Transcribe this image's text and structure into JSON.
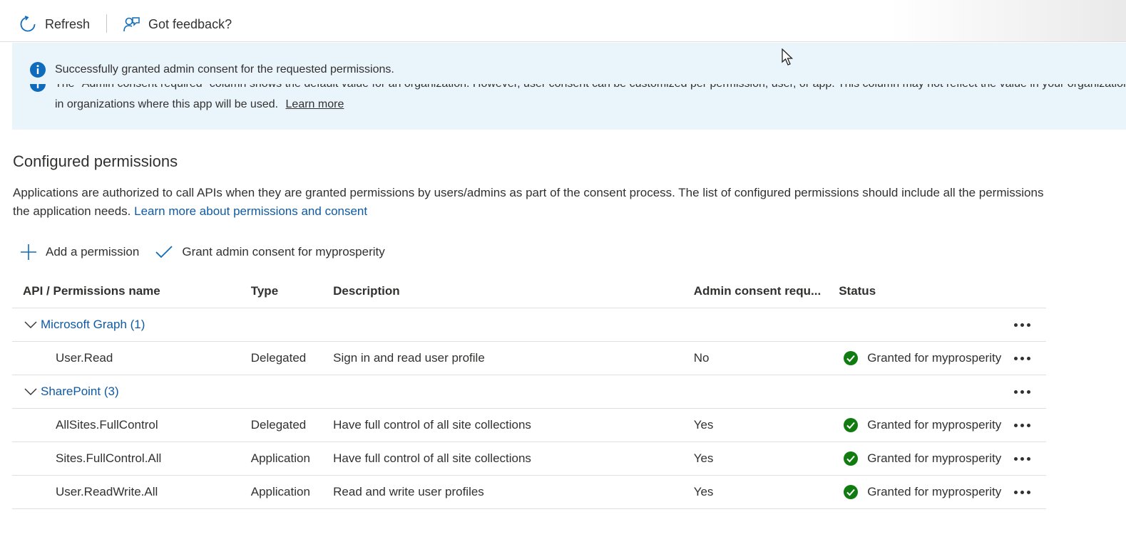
{
  "toolbar": {
    "refresh_label": "Refresh",
    "refresh_icon": "refresh-icon",
    "feedback_label": "Got feedback?",
    "feedback_icon": "feedback-icon"
  },
  "banner": {
    "success_message": "Successfully granted admin consent for the requested permissions.",
    "partial_line": "The \"Admin consent required\" column shows the default value for an organization. However, user consent can be customized per permission, user, or app. This column may not reflect the value in your organization, or",
    "info_text": "in organizations where this app will be used.",
    "learn_more": "Learn more",
    "info_color": "#0f6cbd",
    "background": "#eaf4fb"
  },
  "section": {
    "title": "Configured permissions",
    "description": "Applications are authorized to call APIs when they are granted permissions by users/admins as part of the consent process. The list of configured permissions should include all the permissions the application needs.",
    "link": "Learn more about permissions and consent"
  },
  "actions": {
    "add_permission": "Add a permission",
    "grant_consent": "Grant admin consent for myprosperity"
  },
  "table": {
    "headers": [
      "API / Permissions name",
      "Type",
      "Description",
      "Admin consent requ...",
      "Status"
    ],
    "groups": [
      {
        "name": "Microsoft Graph (1)",
        "rows": [
          {
            "name": "User.Read",
            "type": "Delegated",
            "description": "Sign in and read user profile",
            "admin_consent": "No",
            "status": "Granted for myprosperity"
          }
        ]
      },
      {
        "name": "SharePoint (3)",
        "rows": [
          {
            "name": "AllSites.FullControl",
            "type": "Delegated",
            "description": "Have full control of all site collections",
            "admin_consent": "Yes",
            "status": "Granted for myprosperity"
          },
          {
            "name": "Sites.FullControl.All",
            "type": "Application",
            "description": "Have full control of all site collections",
            "admin_consent": "Yes",
            "status": "Granted for myprosperity"
          },
          {
            "name": "User.ReadWrite.All",
            "type": "Application",
            "description": "Read and write user profiles",
            "admin_consent": "Yes",
            "status": "Granted for myprosperity"
          }
        ]
      }
    ],
    "status_color": "#107c10",
    "link_color": "#0f5aa3"
  }
}
